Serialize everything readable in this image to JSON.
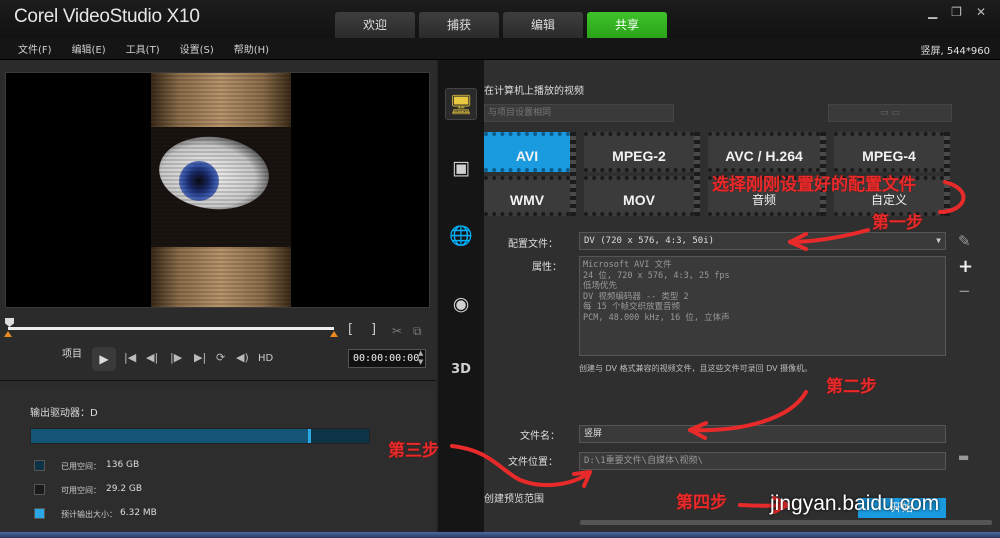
{
  "app": {
    "logo": "Corel VideoStudio X10"
  },
  "tabs": [
    {
      "label": "欢迎"
    },
    {
      "label": "捕获"
    },
    {
      "label": "编辑"
    },
    {
      "label": "共享"
    }
  ],
  "window_controls": {
    "minimize": "▁",
    "restore": "❐",
    "close": "✕"
  },
  "menu": [
    {
      "label": "文件(F)"
    },
    {
      "label": "编辑(E)"
    },
    {
      "label": "工具(T)"
    },
    {
      "label": "设置(S)"
    },
    {
      "label": "帮助(H)"
    }
  ],
  "aspect_mode": "竖屏, 544*960",
  "player": {
    "project_label": "项目",
    "hd_label": "HD",
    "timecode": "00:00:00:00",
    "brackets": [
      "[",
      "]"
    ]
  },
  "drive": {
    "label": "输出驱动器：D",
    "used_fraction": 0.82,
    "legend": [
      {
        "name": "已用空间：",
        "value": "136 GB",
        "color": "#0f3346"
      },
      {
        "name": "可用空间：",
        "value": "29.2 GB",
        "color": "#1a1a1a"
      },
      {
        "name": "预计输出大小：",
        "value": "6.32 MB",
        "color": "#2aa8e6"
      }
    ]
  },
  "share": {
    "subtitle": "在计算机上播放的视频",
    "project_select": "与项目设置相同",
    "formats": [
      {
        "label": "AVI"
      },
      {
        "label": "MPEG-2"
      },
      {
        "label": "AVC / H.264"
      },
      {
        "label": "MPEG-4"
      },
      {
        "label": "WMV"
      },
      {
        "label": "MOV"
      },
      {
        "label": "音频"
      },
      {
        "label": "自定义"
      }
    ],
    "profile_label": "配置文件：",
    "profile_value": "DV (720 x 576, 4:3, 50i)",
    "properties_label": "属性：",
    "properties": [
      "Microsoft AVI 文件",
      "24 位, 720 x 576, 4:3, 25 fps",
      "低场优先",
      "DV 视频编码器 -- 类型 2",
      "每 15 个帧交织放置音频",
      "PCM, 48.000 kHz, 16 位, 立体声"
    ],
    "note": "创建与 DV 格式兼容的视频文件，且这些文件可录回 DV 摄像机。",
    "filename_label": "文件名：",
    "filename_value": "竖屏",
    "location_label": "文件位置：",
    "location_value": "D:\\1重要文件\\自媒体\\视频\\",
    "preview_range": "创建预览范围",
    "start_button": "开始"
  },
  "annotations": {
    "select_profile": "选择刚刚设置好的配置文件",
    "step1": "第一步",
    "step2": "第二步",
    "step3": "第三步",
    "step4": "第四步",
    "color": "#e82a2a"
  },
  "watermark": "jingyan.baidu.com"
}
